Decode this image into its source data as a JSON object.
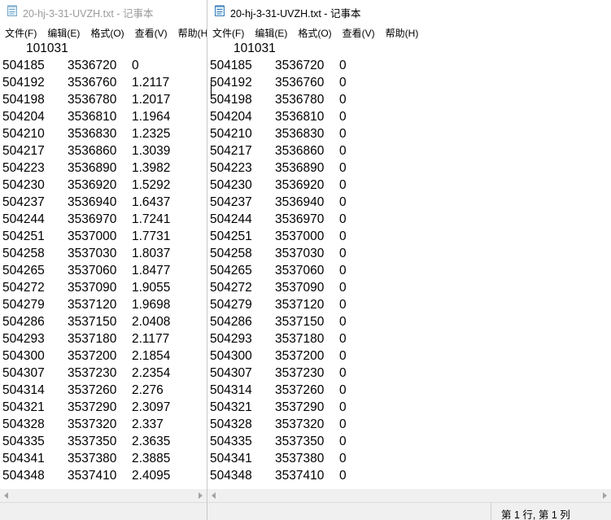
{
  "left_window": {
    "title": "20-hj-3-31-UVZH.txt - 记事本",
    "menu": [
      "文件(F)",
      "编辑(E)",
      "格式(O)",
      "查看(V)",
      "帮助(H)"
    ],
    "header_line": "101031",
    "rows": [
      [
        "504185",
        "3536720",
        "0"
      ],
      [
        "504192",
        "3536760",
        "1.2117"
      ],
      [
        "504198",
        "3536780",
        "1.2017"
      ],
      [
        "504204",
        "3536810",
        "1.1964"
      ],
      [
        "504210",
        "3536830",
        "1.2325"
      ],
      [
        "504217",
        "3536860",
        "1.3039"
      ],
      [
        "504223",
        "3536890",
        "1.3982"
      ],
      [
        "504230",
        "3536920",
        "1.5292"
      ],
      [
        "504237",
        "3536940",
        "1.6437"
      ],
      [
        "504244",
        "3536970",
        "1.7241"
      ],
      [
        "504251",
        "3537000",
        "1.7731"
      ],
      [
        "504258",
        "3537030",
        "1.8037"
      ],
      [
        "504265",
        "3537060",
        "1.8477"
      ],
      [
        "504272",
        "3537090",
        "1.9055"
      ],
      [
        "504279",
        "3537120",
        "1.9698"
      ],
      [
        "504286",
        "3537150",
        "2.0408"
      ],
      [
        "504293",
        "3537180",
        "2.1177"
      ],
      [
        "504300",
        "3537200",
        "2.1854"
      ],
      [
        "504307",
        "3537230",
        "2.2354"
      ],
      [
        "504314",
        "3537260",
        "2.276"
      ],
      [
        "504321",
        "3537290",
        "2.3097"
      ],
      [
        "504328",
        "3537320",
        "2.337"
      ],
      [
        "504335",
        "3537350",
        "2.3635"
      ],
      [
        "504341",
        "3537380",
        "2.3885"
      ],
      [
        "504348",
        "3537410",
        "2.4095"
      ]
    ]
  },
  "right_window": {
    "title": "20-hj-3-31-UVZH.txt - 记事本",
    "menu": [
      "文件(F)",
      "编辑(E)",
      "格式(O)",
      "查看(V)",
      "帮助(H)"
    ],
    "header_line": "101031",
    "rows": [
      [
        "504185",
        "3536720",
        "0"
      ],
      [
        "504192",
        "3536760",
        "0"
      ],
      [
        "504198",
        "3536780",
        "0"
      ],
      [
        "504204",
        "3536810",
        "0"
      ],
      [
        "504210",
        "3536830",
        "0"
      ],
      [
        "504217",
        "3536860",
        "0"
      ],
      [
        "504223",
        "3536890",
        "0"
      ],
      [
        "504230",
        "3536920",
        "0"
      ],
      [
        "504237",
        "3536940",
        "0"
      ],
      [
        "504244",
        "3536970",
        "0"
      ],
      [
        "504251",
        "3537000",
        "0"
      ],
      [
        "504258",
        "3537030",
        "0"
      ],
      [
        "504265",
        "3537060",
        "0"
      ],
      [
        "504272",
        "3537090",
        "0"
      ],
      [
        "504279",
        "3537120",
        "0"
      ],
      [
        "504286",
        "3537150",
        "0"
      ],
      [
        "504293",
        "3537180",
        "0"
      ],
      [
        "504300",
        "3537200",
        "0"
      ],
      [
        "504307",
        "3537230",
        "0"
      ],
      [
        "504314",
        "3537260",
        "0"
      ],
      [
        "504321",
        "3537290",
        "0"
      ],
      [
        "504328",
        "3537320",
        "0"
      ],
      [
        "504335",
        "3537350",
        "0"
      ],
      [
        "504341",
        "3537380",
        "0"
      ],
      [
        "504348",
        "3537410",
        "0"
      ]
    ],
    "status": "第 1 行, 第 1 列"
  },
  "icons": {
    "app_icon": "notepad-icon"
  },
  "colors": {
    "inactive_title": "#9b9b9b",
    "active_title": "#000000",
    "chrome_gray": "#f0f0f0"
  }
}
